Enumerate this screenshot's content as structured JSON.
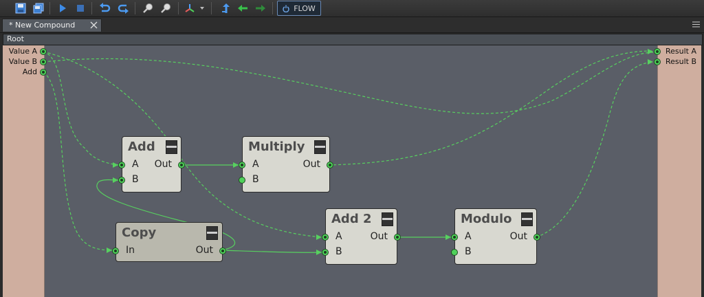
{
  "toolbar": {
    "flow_label": "FLOW",
    "icons": [
      "save-icon",
      "save-all-icon",
      "run-icon",
      "stop-icon",
      "undo-icon",
      "redo-icon",
      "zoom-in-icon",
      "zoom-out-icon",
      "axis-icon",
      "up-icon",
      "back-icon",
      "forward-icon",
      "power-icon"
    ]
  },
  "tab": {
    "label": "* New Compound"
  },
  "breadcrumb": {
    "label": "Root"
  },
  "inputs": [
    "Value A",
    "Value B",
    "Add"
  ],
  "outputs": [
    "Result A",
    "Result B"
  ],
  "nodes": {
    "add": {
      "title": "Add",
      "in": [
        "A",
        "B"
      ],
      "out": "Out"
    },
    "multiply": {
      "title": "Multiply",
      "in": [
        "A",
        "B"
      ],
      "out": "Out"
    },
    "copy": {
      "title": "Copy",
      "in": [
        "In"
      ],
      "out": "Out"
    },
    "add2": {
      "title": "Add 2",
      "in": [
        "A",
        "B"
      ],
      "out": "Out"
    },
    "modulo": {
      "title": "Modulo",
      "in": [
        "A",
        "B"
      ],
      "out": "Out"
    }
  },
  "colors": {
    "wire": "#57d15f",
    "canvas": "#5a5e67",
    "io_panel": "#cfae9f",
    "node": "#d8d8d0",
    "copy_node": "#b9b8ad"
  }
}
